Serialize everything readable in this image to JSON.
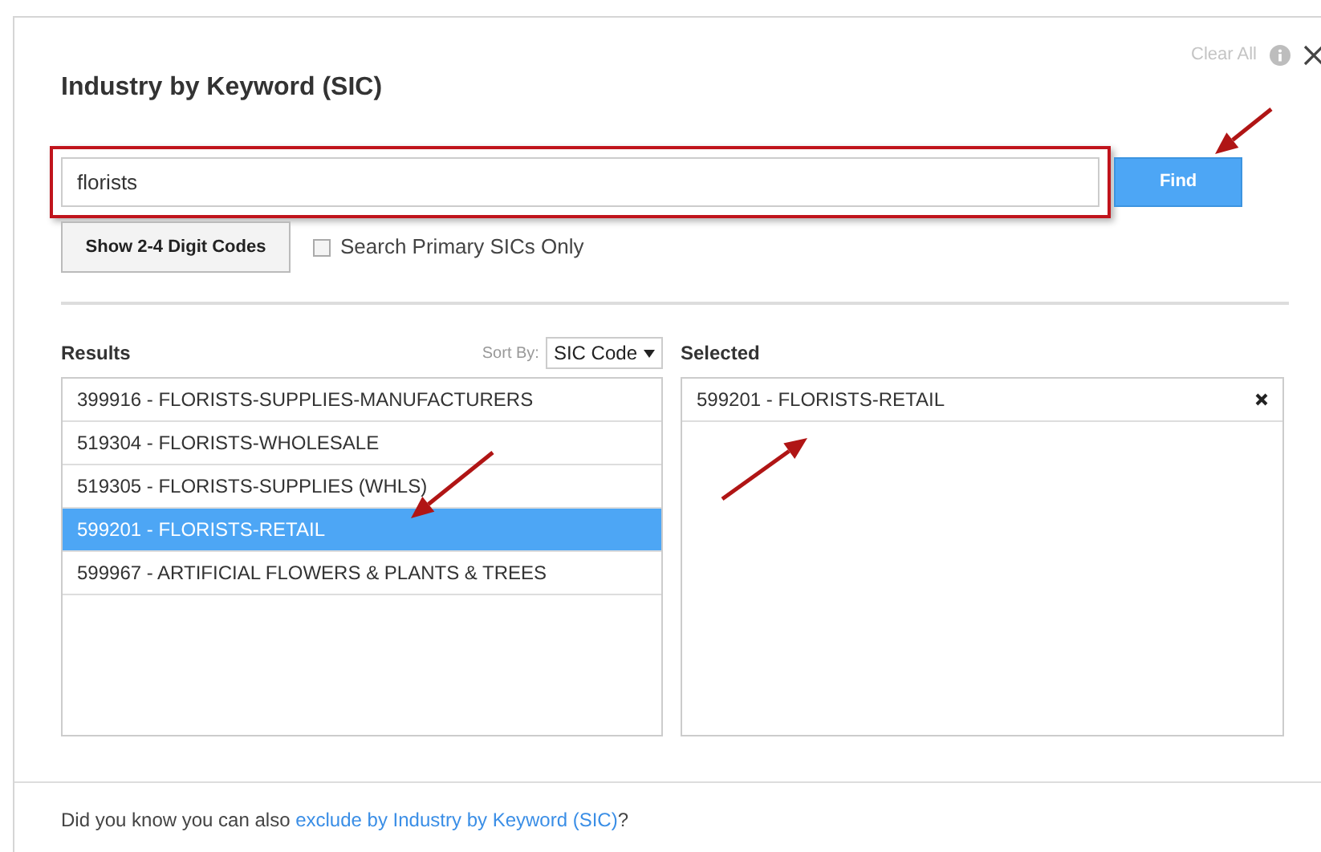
{
  "dialog": {
    "title": "Industry by Keyword (SIC)",
    "clear_all": "Clear All"
  },
  "search": {
    "value": "florists",
    "highlighted": true,
    "button": "Find"
  },
  "show_codes_button": "Show 2-4 Digit Codes",
  "primary_only": {
    "label": "Search Primary SICs Only",
    "checked": false
  },
  "results": {
    "title": "Results",
    "sort_label": "Sort By:",
    "sort_value": "SIC Code",
    "items": [
      {
        "label": "399916 - FLORISTS-SUPPLIES-MANUFACTURERS",
        "selected": false
      },
      {
        "label": "519304 - FLORISTS-WHOLESALE",
        "selected": false
      },
      {
        "label": "519305 - FLORISTS-SUPPLIES (WHLS)",
        "selected": false
      },
      {
        "label": "599201 - FLORISTS-RETAIL",
        "selected": true
      },
      {
        "label": "599967 - ARTIFICIAL FLOWERS & PLANTS & TREES",
        "selected": false
      }
    ]
  },
  "selected": {
    "title": "Selected",
    "items": [
      {
        "label": "599201 - FLORISTS-RETAIL"
      }
    ]
  },
  "footer": {
    "prefix": "Did you know you can also ",
    "link": "exclude by Industry by Keyword (SIC)",
    "suffix": "?"
  }
}
